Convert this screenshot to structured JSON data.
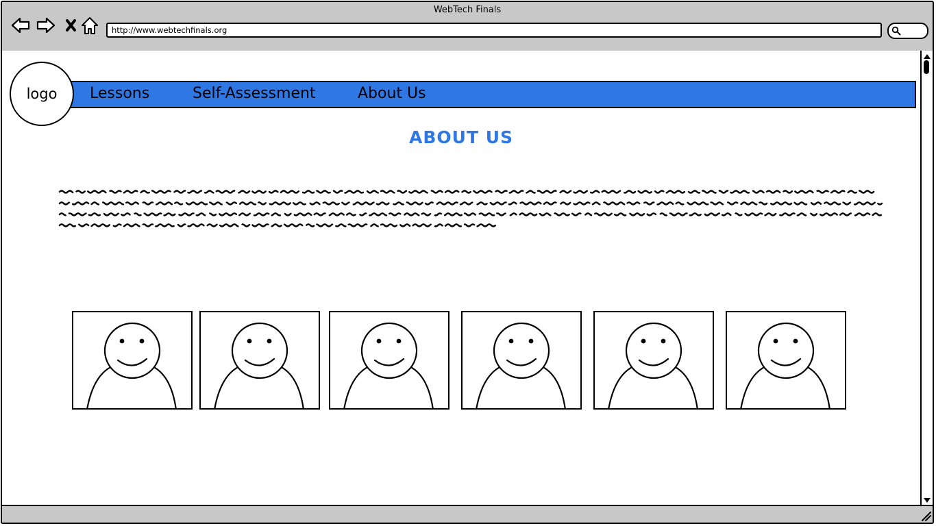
{
  "window": {
    "title": "WebTech Finals"
  },
  "browser": {
    "url": "http://www.webtechfinals.org",
    "icons": [
      "back-arrow-icon",
      "forward-arrow-icon",
      "close-icon",
      "home-icon",
      "search-icon"
    ]
  },
  "site": {
    "logo_text": "logo",
    "nav": [
      {
        "label": "Lessons"
      },
      {
        "label": "Self-Assessment"
      },
      {
        "label": "About Us"
      }
    ],
    "page_heading": "ABOUT US",
    "accent_color": "#2f77e3",
    "team_members": [
      {
        "icon": "person-avatar-icon"
      },
      {
        "icon": "person-avatar-icon"
      },
      {
        "icon": "person-avatar-icon"
      },
      {
        "icon": "person-avatar-icon"
      },
      {
        "icon": "person-avatar-icon"
      },
      {
        "icon": "person-avatar-icon"
      }
    ]
  }
}
